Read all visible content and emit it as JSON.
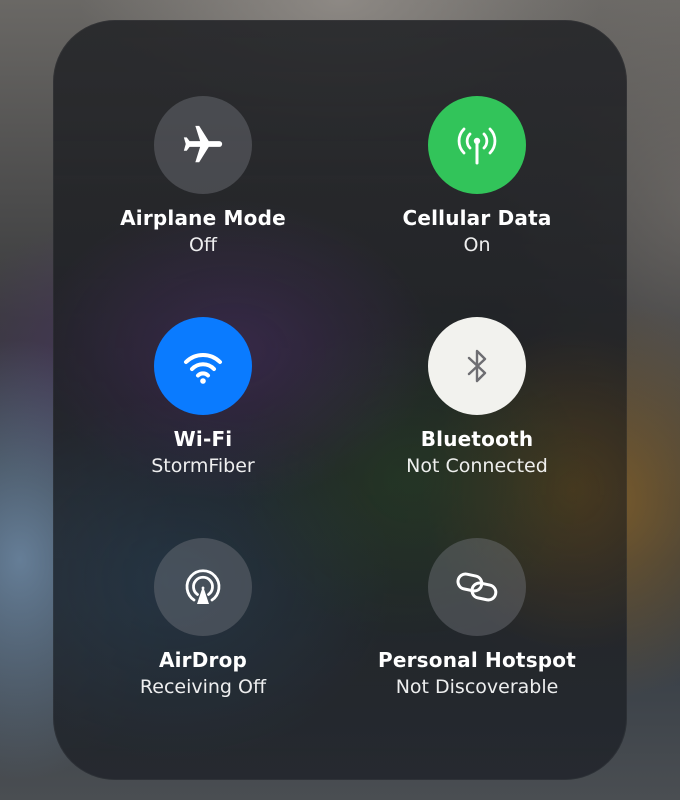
{
  "colors": {
    "cellular_active": "#32c45a",
    "wifi_active": "#0a7bff",
    "bluetooth_active": "#f2f2ee",
    "inactive": "#5d5f63"
  },
  "tiles": [
    {
      "icon": "airplane-icon",
      "title": "Airplane Mode",
      "status": "Off",
      "active": false
    },
    {
      "icon": "antenna-icon",
      "title": "Cellular Data",
      "status": "On",
      "active": true
    },
    {
      "icon": "wifi-icon",
      "title": "Wi-Fi",
      "status": "StormFiber",
      "active": true
    },
    {
      "icon": "bluetooth-icon",
      "title": "Bluetooth",
      "status": "Not Connected",
      "active": true
    },
    {
      "icon": "airdrop-icon",
      "title": "AirDrop",
      "status": "Receiving Off",
      "active": false
    },
    {
      "icon": "hotspot-icon",
      "title": "Personal Hotspot",
      "status": "Not Discoverable",
      "active": false
    }
  ]
}
